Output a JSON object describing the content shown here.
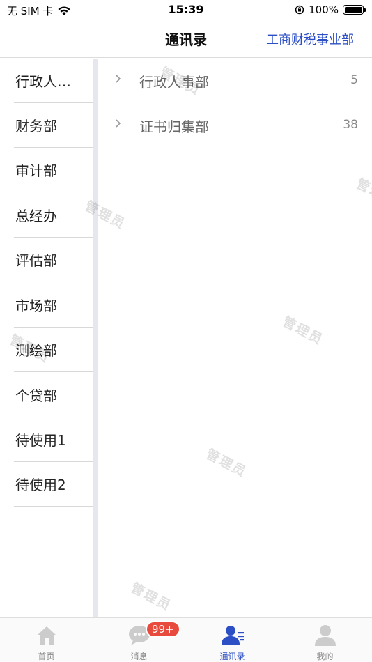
{
  "status_bar": {
    "carrier": "无 SIM 卡",
    "time": "15:39",
    "battery_percent": "100%",
    "battery_level": 1.0
  },
  "nav": {
    "title": "通讯录",
    "right_action": "工商财税事业部"
  },
  "sidebar": {
    "items": [
      {
        "label": "行政人…"
      },
      {
        "label": "财务部"
      },
      {
        "label": "审计部"
      },
      {
        "label": "总经办"
      },
      {
        "label": "评估部"
      },
      {
        "label": "市场部"
      },
      {
        "label": "测绘部"
      },
      {
        "label": "个贷部"
      },
      {
        "label": "待使用1"
      },
      {
        "label": "待使用2"
      }
    ]
  },
  "sub_departments": [
    {
      "name": "行政人事部",
      "count": "5"
    },
    {
      "name": "证书归集部",
      "count": "38"
    }
  ],
  "watermark": "管理员",
  "tabs": [
    {
      "label": "首页",
      "icon": "home-icon"
    },
    {
      "label": "消息",
      "icon": "chat-bubble-icon",
      "badge": "99+"
    },
    {
      "label": "通讯录",
      "icon": "contacts-icon",
      "active": true
    },
    {
      "label": "我的",
      "icon": "profile-icon"
    }
  ],
  "colors": {
    "accent": "#2d4fc6",
    "badge": "#e94a3e",
    "inactive_icon": "#cccccc",
    "divider": "#e6e7ee"
  }
}
